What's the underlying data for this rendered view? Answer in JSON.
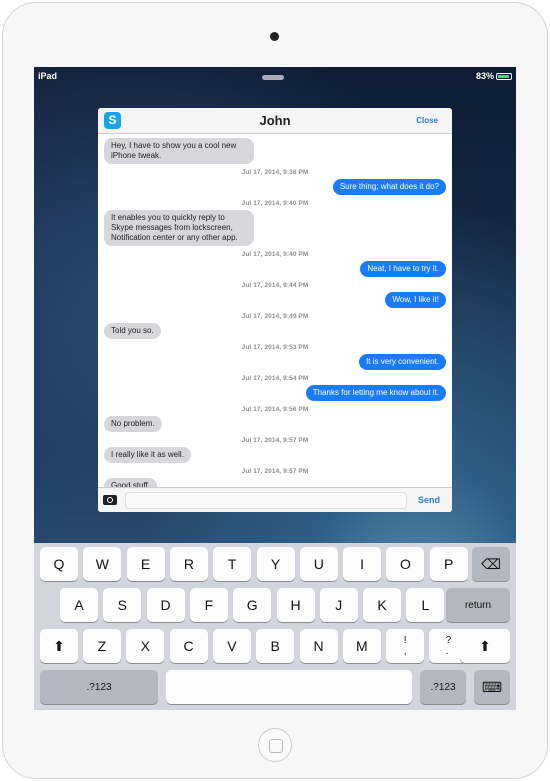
{
  "status": {
    "device": "iPad",
    "battery": "83%",
    "battery_level": 0.83
  },
  "dialog": {
    "title": "John",
    "close": "Close",
    "send": "Send",
    "input_value": "",
    "app_icon": "skype-icon"
  },
  "messages": [
    {
      "dir": "in",
      "text": "Hey, I have to show you a cool new iPhone tweak."
    },
    {
      "ts": "Jul 17, 2014, 9:38 PM"
    },
    {
      "dir": "out",
      "text": "Sure thing; what does it do?"
    },
    {
      "ts": "Jul 17, 2014, 9:40 PM"
    },
    {
      "dir": "in",
      "text": "It enables you to quickly reply to Skype messages from lockscreen, Notification center or any other app."
    },
    {
      "ts": "Jul 17, 2014, 9:40 PM"
    },
    {
      "dir": "out",
      "text": "Neat, I have to try it."
    },
    {
      "ts": "Jul 17, 2014, 9:44 PM"
    },
    {
      "dir": "out",
      "text": "Wow, I like it!"
    },
    {
      "ts": "Jul 17, 2014, 9:49 PM"
    },
    {
      "dir": "in",
      "text": "Told you so."
    },
    {
      "ts": "Jul 17, 2014, 9:53 PM"
    },
    {
      "dir": "out",
      "text": "It is very convenient."
    },
    {
      "ts": "Jul 17, 2014, 9:54 PM"
    },
    {
      "dir": "out",
      "text": "Thanks for letting me know about it."
    },
    {
      "ts": "Jul 17, 2014, 9:56 PM"
    },
    {
      "dir": "in",
      "text": "No problem."
    },
    {
      "ts": "Jul 17, 2014, 9:57 PM"
    },
    {
      "dir": "in",
      "text": "I really like it as well."
    },
    {
      "ts": "Jul 17, 2014, 9:57 PM"
    },
    {
      "dir": "in",
      "text": "Good stuff."
    }
  ],
  "keyboard": {
    "row1": [
      "Q",
      "W",
      "E",
      "R",
      "T",
      "Y",
      "U",
      "I",
      "O",
      "P"
    ],
    "backspace": "⌫",
    "row2": [
      "A",
      "S",
      "D",
      "F",
      "G",
      "H",
      "J",
      "K",
      "L"
    ],
    "return": "return",
    "shift": "⬆",
    "row3": [
      "Z",
      "X",
      "C",
      "V",
      "B",
      "N",
      "M",
      "!\n,",
      "?\n."
    ],
    "numbers": ".?123",
    "hide": "⌨"
  }
}
